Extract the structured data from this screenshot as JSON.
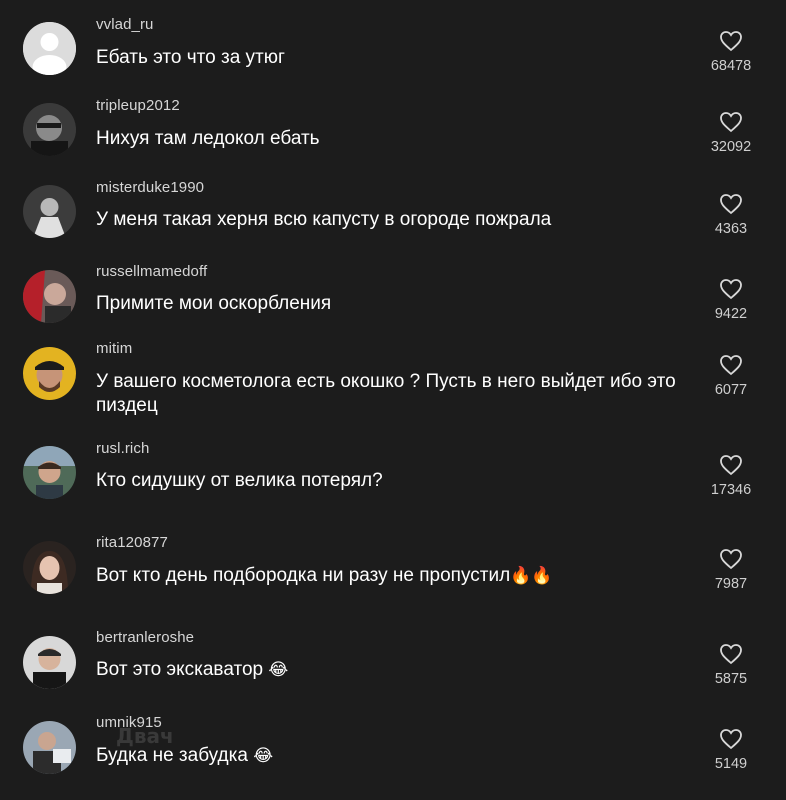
{
  "comments": [
    {
      "username": "vvlad_ru",
      "text": "Ебать это что за утюг",
      "likes": "68478",
      "emoji": ""
    },
    {
      "username": "tripleup2012",
      "text": "Нихуя там ледокол ебать",
      "likes": "32092",
      "emoji": ""
    },
    {
      "username": "misterduke1990",
      "text": "У меня такая херня всю капусту в огороде пожрала",
      "likes": "4363",
      "emoji": ""
    },
    {
      "username": "russellmamedoff",
      "text": "Примите мои оскорбления",
      "likes": "9422",
      "emoji": ""
    },
    {
      "username": "mitim",
      "text": "У вашего косметолога есть окошко ? Пусть в него выйдет ибо это пиздец",
      "likes": "6077",
      "emoji": ""
    },
    {
      "username": "rusl.rich",
      "text": "Кто сидушку от велика потерял?",
      "likes": "17346",
      "emoji": ""
    },
    {
      "username": "rita120877",
      "text": "Вот кто день подбородка ни разу не пропустил",
      "likes": "7987",
      "emoji": "🔥🔥"
    },
    {
      "username": "bertranleroshe",
      "text": "Вот это экскаватор",
      "likes": "5875",
      "emoji": "😂"
    },
    {
      "username": "umnik915",
      "text": "Будка не забудка",
      "likes": "5149",
      "emoji": "😂"
    }
  ],
  "watermark": "Двач",
  "icons": {
    "like": "heart-outline-icon"
  },
  "colors": {
    "background": "#1c1c1c",
    "text": "#ffffff",
    "secondary": "#cfcfcf"
  }
}
